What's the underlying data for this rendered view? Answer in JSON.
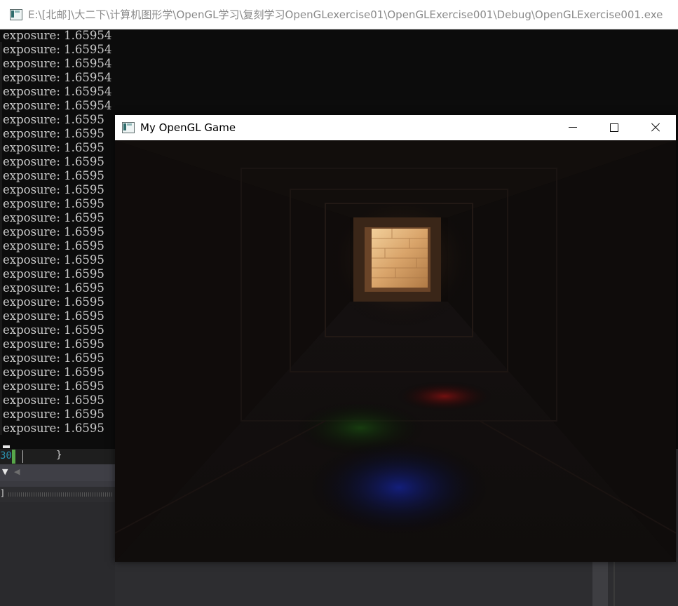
{
  "console": {
    "title": "E:\\[北邮]\\大二下\\计算机图形学\\OpenGL学习\\复刻学习OpenGLexercise01\\OpenGLExercise001\\Debug\\OpenGLExercise001.exe",
    "lines": [
      "exposure: 1.65954",
      "exposure: 1.65954",
      "exposure: 1.65954",
      "exposure: 1.65954",
      "exposure: 1.65954",
      "exposure: 1.65954",
      "exposure: 1.6595",
      "exposure: 1.6595",
      "exposure: 1.6595",
      "exposure: 1.6595",
      "exposure: 1.6595",
      "exposure: 1.6595",
      "exposure: 1.6595",
      "exposure: 1.6595",
      "exposure: 1.6595",
      "exposure: 1.6595",
      "exposure: 1.6595",
      "exposure: 1.6595",
      "exposure: 1.6595",
      "exposure: 1.6595",
      "exposure: 1.6595",
      "exposure: 1.6595",
      "exposure: 1.6595",
      "exposure: 1.6595",
      "exposure: 1.6595",
      "exposure: 1.6595",
      "exposure: 1.6595",
      "exposure: 1.6595",
      "exposure: 1.6595"
    ]
  },
  "ide": {
    "line_number": "30",
    "code_text": "}",
    "bracket_text": "]"
  },
  "gl_window": {
    "title": "My OpenGL Game",
    "minimize_icon": "minimize-icon",
    "maximize_icon": "maximize-icon",
    "close_icon": "close-icon"
  },
  "colors": {
    "console_bg": "#0c0c0c",
    "console_text": "#cccccc",
    "ide_bg": "#2d2d30",
    "light_red": "#8a1010",
    "light_green": "#104a10",
    "light_blue": "#101a8a",
    "wood_light": "#e8c08a"
  }
}
